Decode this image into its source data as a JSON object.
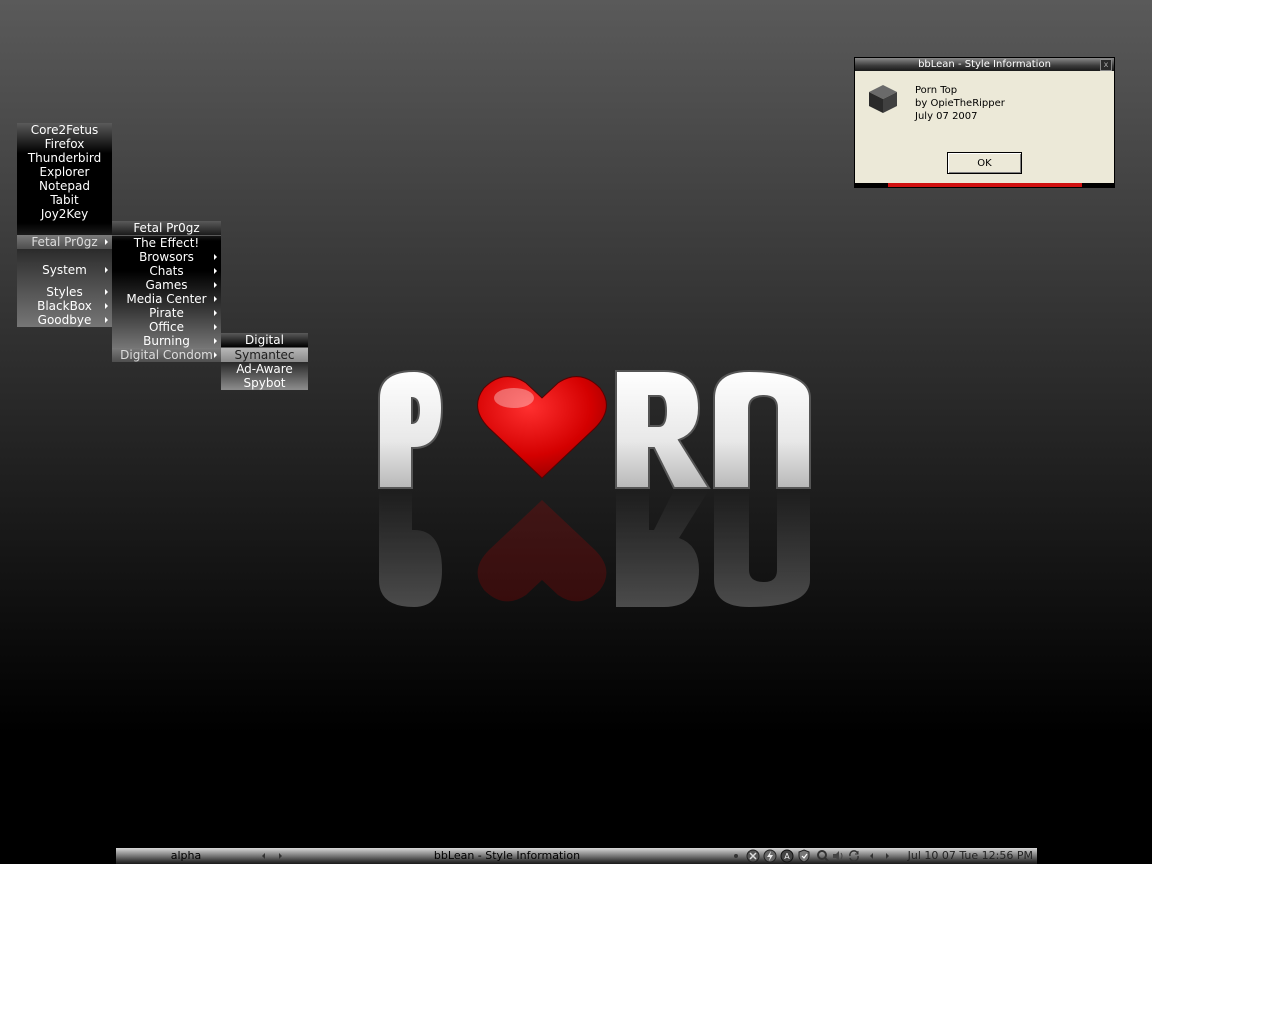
{
  "main_menu": {
    "items": [
      {
        "label": "Core2Fetus"
      },
      {
        "label": "Firefox"
      },
      {
        "label": "Thunderbird"
      },
      {
        "label": "Explorer"
      },
      {
        "label": "Notepad"
      },
      {
        "label": "Tabit"
      },
      {
        "label": "Joy2Key"
      },
      {
        "label": "Fetal Pr0gz"
      },
      {
        "label": "System"
      },
      {
        "label": "Styles"
      },
      {
        "label": "BlackBox"
      },
      {
        "label": "Goodbye"
      }
    ]
  },
  "sub_menu_1": {
    "title": "Fetal Pr0gz",
    "items": [
      {
        "label": "The Effect!"
      },
      {
        "label": "Browsors"
      },
      {
        "label": "Chats"
      },
      {
        "label": "Games"
      },
      {
        "label": "Media Center"
      },
      {
        "label": "Pirate"
      },
      {
        "label": "Office"
      },
      {
        "label": "Burning"
      },
      {
        "label": "Digital Condom"
      }
    ]
  },
  "sub_menu_2": {
    "title": "Digital Condom",
    "items": [
      {
        "label": "Symantec"
      },
      {
        "label": "Ad-Aware"
      },
      {
        "label": "Spybot"
      }
    ]
  },
  "logo": {
    "letter_1": "P",
    "letter_2": "R",
    "letter_3": "N",
    "heart_color": "#d40000"
  },
  "dialog": {
    "title": "bbLean - Style Information",
    "close_glyph": "x",
    "style_name": "Porn Top",
    "author": "by OpieTheRipper",
    "date": "July 07 2007",
    "ok_label": "OK"
  },
  "taskbar": {
    "workspace": "alpha",
    "task": "bbLean - Style Information",
    "clock": "Jul 10 07 Tue 12:56 PM"
  }
}
